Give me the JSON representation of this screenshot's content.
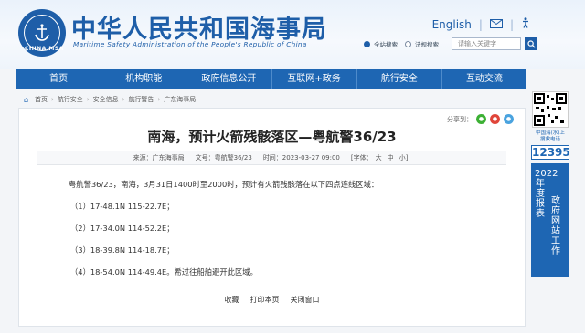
{
  "header": {
    "site_title": "中华人民共和国海事局",
    "site_subtitle": "Maritime Safety Administration of the People's Republic of China",
    "logo_text": "CHINA MSA",
    "english_link": "English",
    "search": {
      "option_site": "全站搜索",
      "option_law": "法规搜索",
      "placeholder": "请输入关键字"
    }
  },
  "nav": {
    "items": [
      "首页",
      "机构职能",
      "政府信息公开",
      "互联网+政务",
      "航行安全",
      "互动交流"
    ]
  },
  "breadcrumb": [
    "首页",
    "航行安全",
    "安全信息",
    "航行警告",
    "广东海事局"
  ],
  "article": {
    "share_label": "分享到：",
    "title": "南海，预计火箭残骸落区—粤航警36/23",
    "source": "来源：广东海事局",
    "doc_no": "文号：粤航警36/23",
    "time": "时间：2023-03-27 09:00",
    "font_label": "[字体：",
    "font_large": "大",
    "font_mid": "中",
    "font_small": "小]",
    "intro": "粤航警36/23，南海，3月31日1400时至2000时，预计有火箭残骸落在以下四点连线区域：",
    "points": [
      "（1）17-48.1N 115-22.7E；",
      "（2）17-34.0N 114-52.2E；",
      "（3）18-39.8N 114-18.7E；",
      "（4）18-54.0N 114-49.4E。希过往船舶避开此区域。"
    ],
    "actions": [
      "收藏",
      "打印本页",
      "关闭窗口"
    ]
  },
  "side": {
    "hotline_label": "中国海(水)上\n搜救电话",
    "hotline": "12395",
    "report_year": "2022年度报表",
    "report_text": "政府网站工作"
  },
  "colors": {
    "brand": "#1e5ea8",
    "nav": "#1e66b3"
  }
}
